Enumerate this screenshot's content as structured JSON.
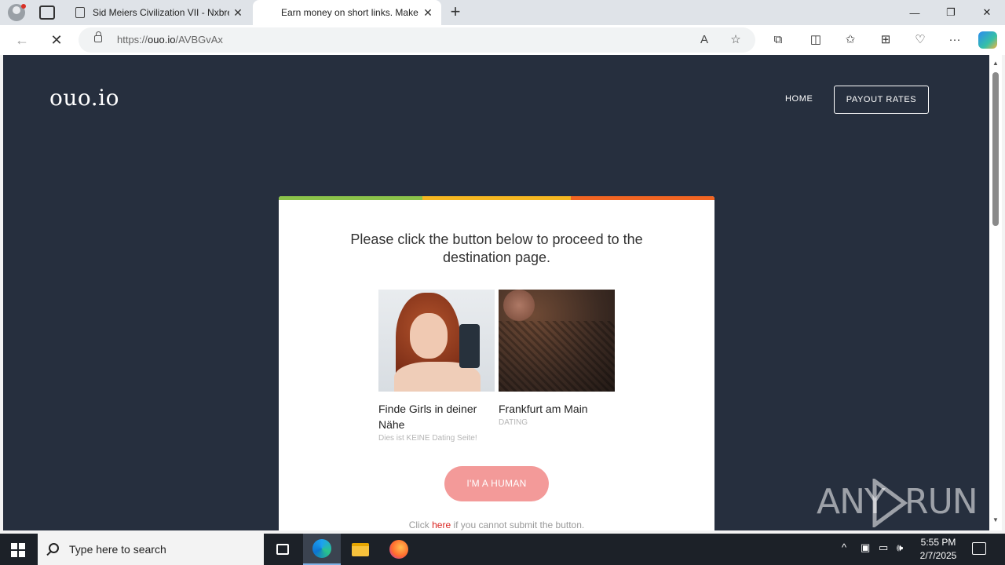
{
  "browser": {
    "tabs": [
      {
        "title": "Sid Meiers Civilization VII - Nxbre"
      },
      {
        "title": "Earn money on short links. Make"
      }
    ],
    "url_prefix": "https://",
    "url_host": "ouo.io",
    "url_path": "/AVBGvAx"
  },
  "site": {
    "logo": "ouo.io",
    "nav": {
      "home": "HOME",
      "payout": "PAYOUT RATES"
    }
  },
  "card": {
    "headline": "Please click the button below to proceed to the destination page.",
    "ads": [
      {
        "title": "Finde Girls in deiner Nähe",
        "subtitle": "Dies ist KEINE Dating Seite!"
      },
      {
        "title": "Frankfurt am Main",
        "subtitle": "DATING"
      }
    ],
    "button": "I'M A HUMAN",
    "footnote_before": "Click ",
    "footnote_link": "here",
    "footnote_after": " if you cannot submit the button."
  },
  "watermark": {
    "left": "ANY",
    "right": "RUN"
  },
  "taskbar": {
    "search_placeholder": "Type here to search",
    "time": "5:55 PM",
    "date": "2/7/2025"
  },
  "colors": {
    "page_bg": "#262f3e",
    "stripe_green": "#8bc34a",
    "stripe_yellow": "#f5b721",
    "stripe_orange": "#f26522",
    "human_button": "#f39a99",
    "link_red": "#d9231f"
  }
}
